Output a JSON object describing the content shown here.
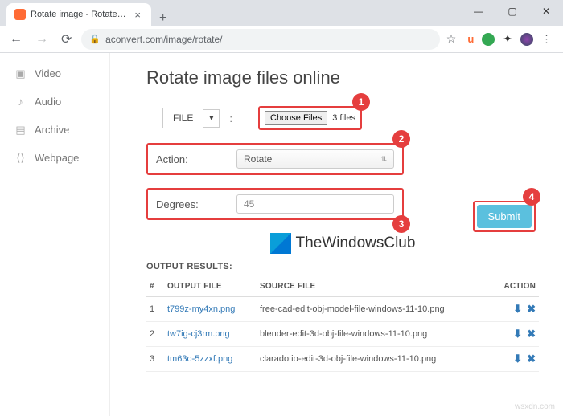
{
  "window": {
    "tab_title": "Rotate image - Rotate JPG, PNG",
    "url": "aconvert.com/image/rotate/"
  },
  "sidebar": {
    "items": [
      {
        "label": "Video"
      },
      {
        "label": "Audio"
      },
      {
        "label": "Archive"
      },
      {
        "label": "Webpage"
      }
    ]
  },
  "page": {
    "title": "Rotate image files online",
    "file_button": "FILE",
    "choose_files": "Choose Files",
    "file_count": "3 files",
    "action_label": "Action:",
    "action_value": "Rotate",
    "degrees_label": "Degrees:",
    "degrees_value": "45",
    "logo_text": "TheWindowsClub",
    "submit": "Submit",
    "results_title": "OUTPUT RESULTS:",
    "badges": {
      "b1": "1",
      "b2": "2",
      "b3": "3",
      "b4": "4"
    },
    "headers": {
      "num": "#",
      "out": "OUTPUT FILE",
      "src": "SOURCE FILE",
      "act": "ACTION"
    },
    "rows": [
      {
        "n": "1",
        "out": "t799z-my4xn.png",
        "src": "free-cad-edit-obj-model-file-windows-11-10.png"
      },
      {
        "n": "2",
        "out": "tw7ig-cj3rm.png",
        "src": "blender-edit-3d-obj-file-windows-11-10.png"
      },
      {
        "n": "3",
        "out": "tm63o-5zzxf.png",
        "src": "claradotio-edit-3d-obj-file-windows-11-10.png"
      }
    ]
  },
  "watermark": "wsxdn.com"
}
